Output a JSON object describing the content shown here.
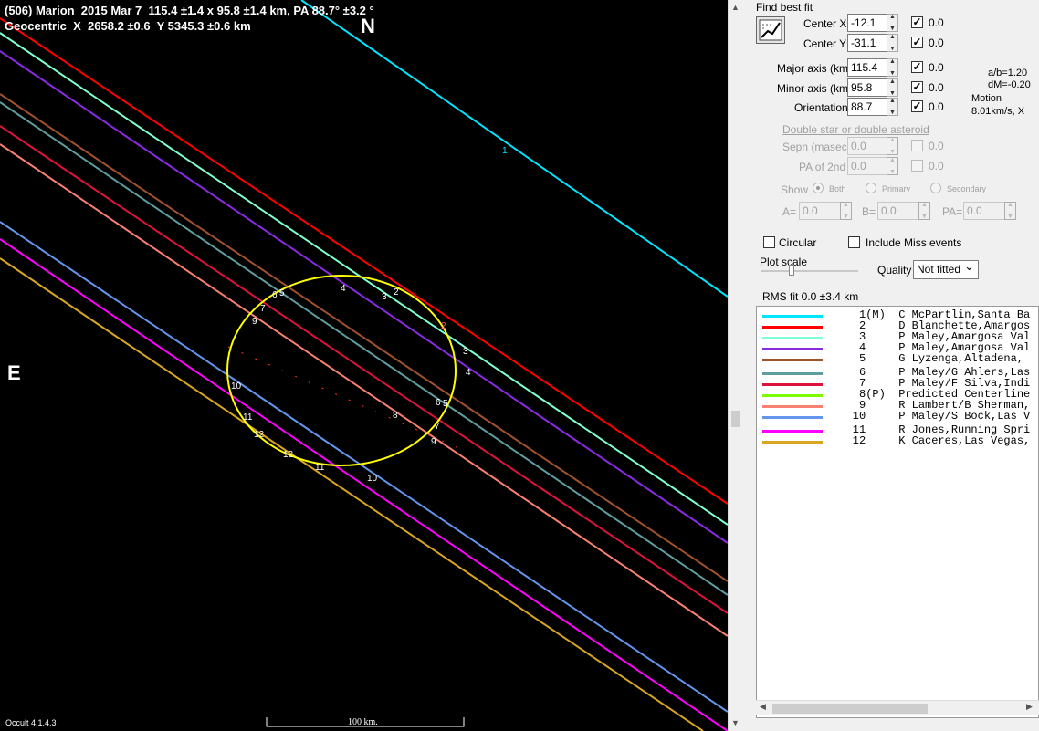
{
  "header": {
    "line1": "(506) Marion  2015 Mar 7  115.4 ±1.4 x 95.8 ±1.4 km, PA 88.7° ±3.2 °",
    "line2": "Geocentric  X  2658.2 ±0.6  Y 5345.3 ±0.6 km"
  },
  "plot": {
    "north_label": "N",
    "east_label": "E",
    "version": "Occult 4.1.4.3",
    "scale_label": "100 km.",
    "chord_numbers": [
      "1",
      "2",
      "2",
      "3",
      "3",
      "4",
      "4",
      "5",
      "5",
      "6",
      "6",
      "7",
      "7",
      "8",
      "9",
      "9",
      "10",
      "10",
      "11",
      "11",
      "12",
      "12"
    ]
  },
  "panel": {
    "find_best_fit": "Find best fit",
    "center_x": {
      "label": "Center X",
      "value": "-12.1",
      "check": "✓",
      "delta": "0.0"
    },
    "center_y": {
      "label": "Center Y",
      "value": "-31.1",
      "check": "✓",
      "delta": "0.0"
    },
    "major_axis": {
      "label": "Major axis (km)",
      "value": "115.4",
      "check": "✓",
      "delta": "0.0"
    },
    "minor_axis": {
      "label": "Minor axis (km)",
      "value": "95.8",
      "check": "✓",
      "delta": "0.0"
    },
    "orientation": {
      "label": "Orientation",
      "value": "88.7",
      "check": "✓",
      "delta": "0.0"
    },
    "ab_ratio": "a/b=1.20",
    "dm": "dM=-0.20",
    "motion_label": "Motion",
    "motion_value": "8.01km/s, X",
    "double_star": "Double star  or  double asteroid",
    "sepn": {
      "label": "Sepn (masec)",
      "value": "0.0",
      "delta": "0.0"
    },
    "pa2nd": {
      "label": "PA of 2nd",
      "value": "0.0",
      "delta": "0.0"
    },
    "show_label": "Show",
    "show_both": "Both",
    "show_primary": "Primary",
    "show_secondary": "Secondary",
    "a_label": "A=",
    "a_value": "0.0",
    "b_label": "B=",
    "b_value": "0.0",
    "pa_label": "PA=",
    "pa_value": "0.0",
    "circular": "Circular",
    "include_miss": "Include Miss events",
    "plot_scale": "Plot scale",
    "quality_label": "Quality",
    "quality_value": "Not fitted",
    "rms_fit": "RMS fit 0.0 ±3.4 km"
  },
  "legend": [
    {
      "num": "1",
      "flag": "(M)",
      "text": "C McPartlin,Santa Ba",
      "color": "#00e5ff"
    },
    {
      "num": "2",
      "flag": "",
      "text": "D Blanchette,Amargos",
      "color": "#ff0000"
    },
    {
      "num": "3",
      "flag": "",
      "text": "P Maley,Amargosa Val",
      "color": "#7fffd4"
    },
    {
      "num": "4",
      "flag": "",
      "text": "P Maley,Amargosa Val",
      "color": "#8a2be2"
    },
    {
      "num": "5",
      "flag": "",
      "text": "G Lyzenga,Altadena,",
      "color": "#a0522d"
    },
    {
      "num": "6",
      "flag": "",
      "text": "P Maley/G Ahlers,Las",
      "color": "#5f9ea0"
    },
    {
      "num": "7",
      "flag": "",
      "text": "P Maley/F Silva,Indi",
      "color": "#dc143c"
    },
    {
      "num": "8",
      "flag": "(P)",
      "text": "Predicted Centerline",
      "color": "#7cfc00"
    },
    {
      "num": "9",
      "flag": "",
      "text": "R Lambert/B Sherman,",
      "color": "#fa8072"
    },
    {
      "num": "10",
      "flag": "",
      "text": "P Maley/S Bock,Las V",
      "color": "#6495ed"
    },
    {
      "num": "11",
      "flag": "",
      "text": "R Jones,Running Spri",
      "color": "#ff00ff"
    },
    {
      "num": "12",
      "flag": "",
      "text": "K Caceres,Las Vegas,",
      "color": "#daa520"
    }
  ]
}
